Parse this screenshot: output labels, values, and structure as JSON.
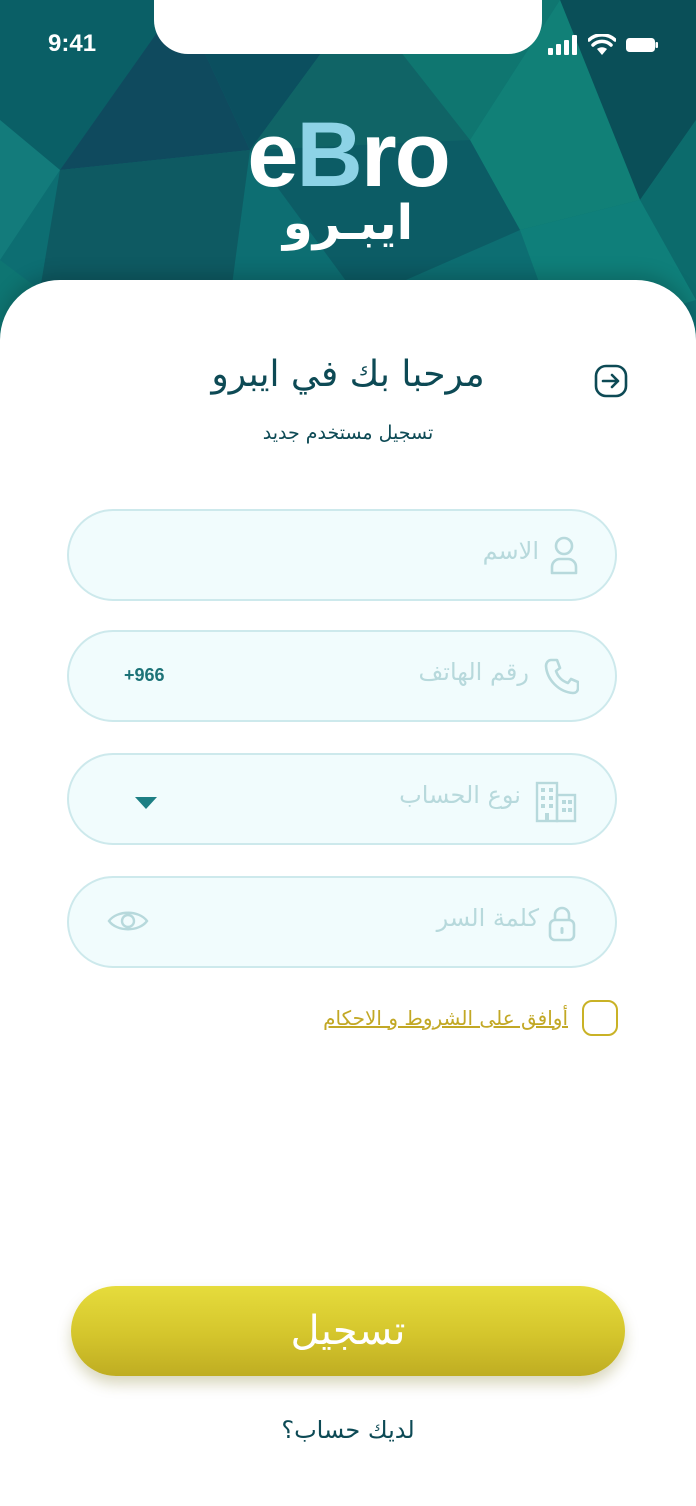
{
  "status_bar": {
    "time": "9:41"
  },
  "brand": {
    "logo_latin_e": "e",
    "logo_latin_b": "B",
    "logo_latin_ro": "ro",
    "logo_arabic": "ايبـرو"
  },
  "header": {
    "title": "مرحبا بك في ايبرو",
    "subtitle": "تسجيل مستخدم جديد"
  },
  "form": {
    "name_placeholder": "الاسم",
    "phone_placeholder": "رقم الهاتف",
    "phone_prefix": "+966",
    "account_type_placeholder": "نوع الحساب",
    "password_placeholder": "كلمة السر"
  },
  "terms": {
    "label": "أوافق على الشروط و الاحكام",
    "checked": false
  },
  "actions": {
    "submit_label": "تسجيل",
    "have_account": "لديك حساب؟"
  },
  "colors": {
    "primary_dark": "#0d4a55",
    "teal_accent": "#1d7f84",
    "button_yellow": "#d4c52c",
    "field_bg": "#f1fcfd",
    "field_border": "#cde9ec",
    "link_gold": "#c2a825"
  },
  "icons": [
    "login-arrow-icon",
    "user-icon",
    "phone-icon",
    "building-icon",
    "lock-icon",
    "eye-icon",
    "caret-down-icon",
    "signal-icon",
    "wifi-icon",
    "battery-icon"
  ]
}
